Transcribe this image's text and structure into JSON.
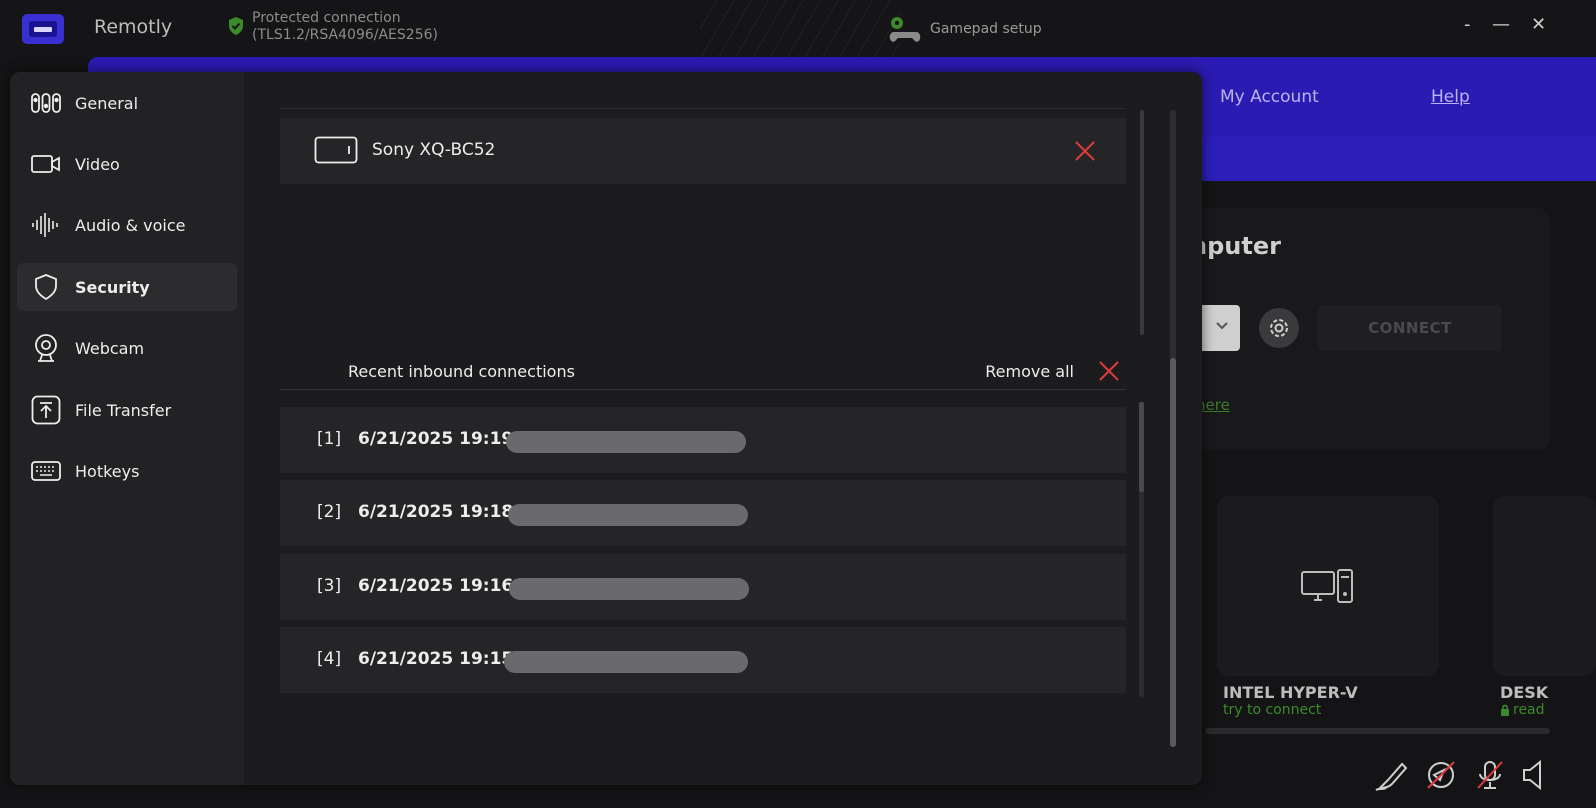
{
  "titlebar": {
    "app_title": "Remotly",
    "connection_line1": "Protected connection",
    "connection_line2": "(TLS1.2/RSA4096/AES256)",
    "gamepad_label": "Gamepad setup",
    "minimize_glyph": "-",
    "maximize_glyph": "—",
    "close_glyph": "✕"
  },
  "background": {
    "nav_my_account": "My Account",
    "nav_help": "Help",
    "heading_fragment": "nputer",
    "connect_label": "CONNECT",
    "link_fragment": "here",
    "cards": [
      {
        "title": "INTEL HYPER-V",
        "subtitle": "try to connect"
      },
      {
        "title": "DESK",
        "subtitle": "read"
      }
    ]
  },
  "sidebar": {
    "items": [
      {
        "label": "General",
        "icon": "sliders-icon"
      },
      {
        "label": "Video",
        "icon": "video-camera-icon"
      },
      {
        "label": "Audio & voice",
        "icon": "audio-wave-icon"
      },
      {
        "label": "Security",
        "icon": "shield-icon",
        "active": true
      },
      {
        "label": "Webcam",
        "icon": "webcam-icon"
      },
      {
        "label": "File Transfer",
        "icon": "upload-icon"
      },
      {
        "label": "Hotkeys",
        "icon": "keyboard-icon"
      }
    ]
  },
  "security": {
    "trusted_device": {
      "name": "Sony XQ-BC52",
      "icon": "tv-icon"
    },
    "recent_title": "Recent inbound connections",
    "remove_all_label": "Remove all",
    "connections": [
      {
        "index": "[1]",
        "time": "6/21/2025 19:19"
      },
      {
        "index": "[2]",
        "time": "6/21/2025 19:18"
      },
      {
        "index": "[3]",
        "time": "6/21/2025 19:16"
      },
      {
        "index": "[4]",
        "time": "6/21/2025 19:15"
      }
    ]
  },
  "colors": {
    "accent_purple": "#2a1bb2",
    "delete_red": "#e03a3a",
    "status_green": "#3c8a2a"
  }
}
